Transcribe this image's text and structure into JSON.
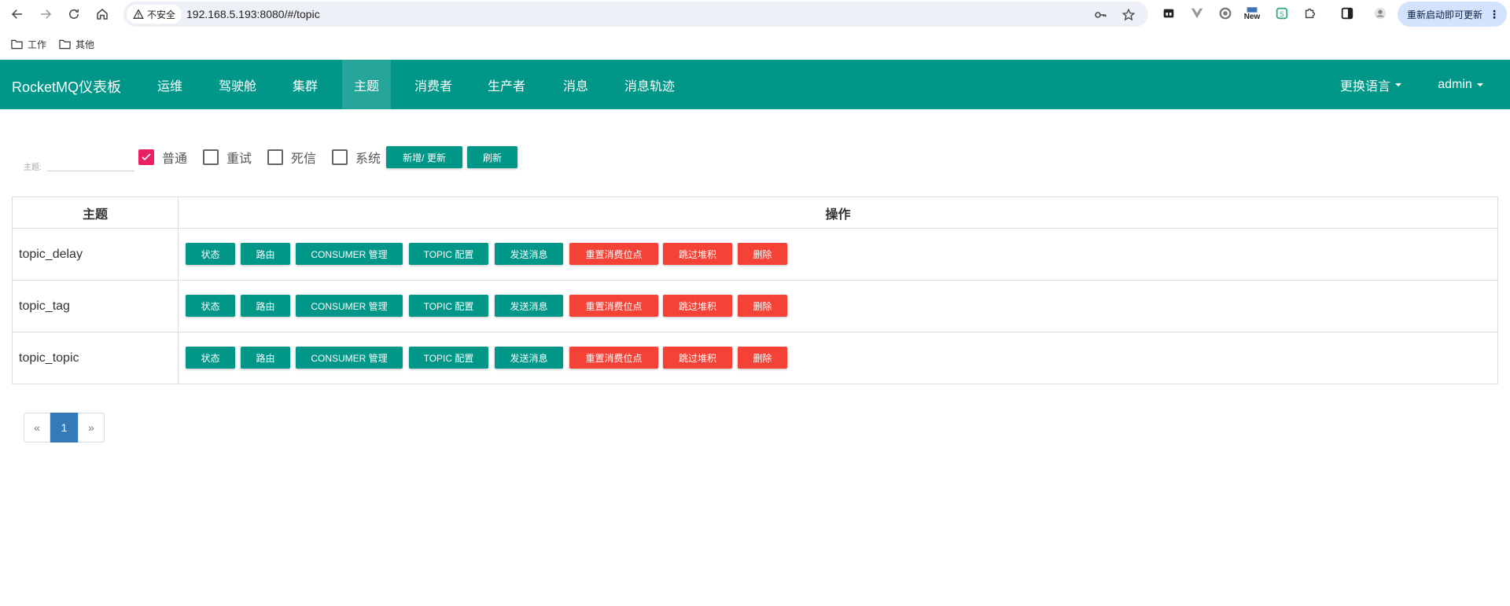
{
  "browser": {
    "security_label": "不安全",
    "url": "192.168.5.193:8080/#/topic",
    "extension_new_label": "New",
    "update_label": "重新启动即可更新",
    "bookmarks": [
      {
        "label": "工作"
      },
      {
        "label": "其他"
      }
    ]
  },
  "navbar": {
    "brand": "RocketMQ仪表板",
    "items": [
      {
        "label": "运维"
      },
      {
        "label": "驾驶舱"
      },
      {
        "label": "集群"
      },
      {
        "label": "主题"
      },
      {
        "label": "消费者"
      },
      {
        "label": "生产者"
      },
      {
        "label": "消息"
      },
      {
        "label": "消息轨迹"
      }
    ],
    "active_item": "主题",
    "language_label": "更换语言",
    "user_label": "admin"
  },
  "filter": {
    "topic_label": "主题:",
    "topic_value": "",
    "checkboxes": [
      {
        "label": "普通",
        "checked": true
      },
      {
        "label": "重试",
        "checked": false
      },
      {
        "label": "死信",
        "checked": false
      },
      {
        "label": "系统",
        "checked": false
      }
    ],
    "add_update_label": "新增/ 更新",
    "refresh_label": "刷新"
  },
  "table": {
    "headers": [
      "主题",
      "操作"
    ],
    "actions": [
      {
        "label": "状态",
        "color": "#009688"
      },
      {
        "label": "路由",
        "color": "#009688"
      },
      {
        "label": "CONSUMER 管理",
        "color": "#009688"
      },
      {
        "label": "TOPIC 配置",
        "color": "#009688"
      },
      {
        "label": "发送消息",
        "color": "#009688"
      },
      {
        "label": "重置消费位点",
        "color": "#f44336"
      },
      {
        "label": "跳过堆积",
        "color": "#f44336"
      },
      {
        "label": "删除",
        "color": "#f44336"
      }
    ],
    "rows": [
      {
        "topic": "topic_delay"
      },
      {
        "topic": "topic_tag"
      },
      {
        "topic": "topic_topic"
      }
    ]
  },
  "pagination": {
    "prev": "«",
    "current": "1",
    "next": "»"
  }
}
